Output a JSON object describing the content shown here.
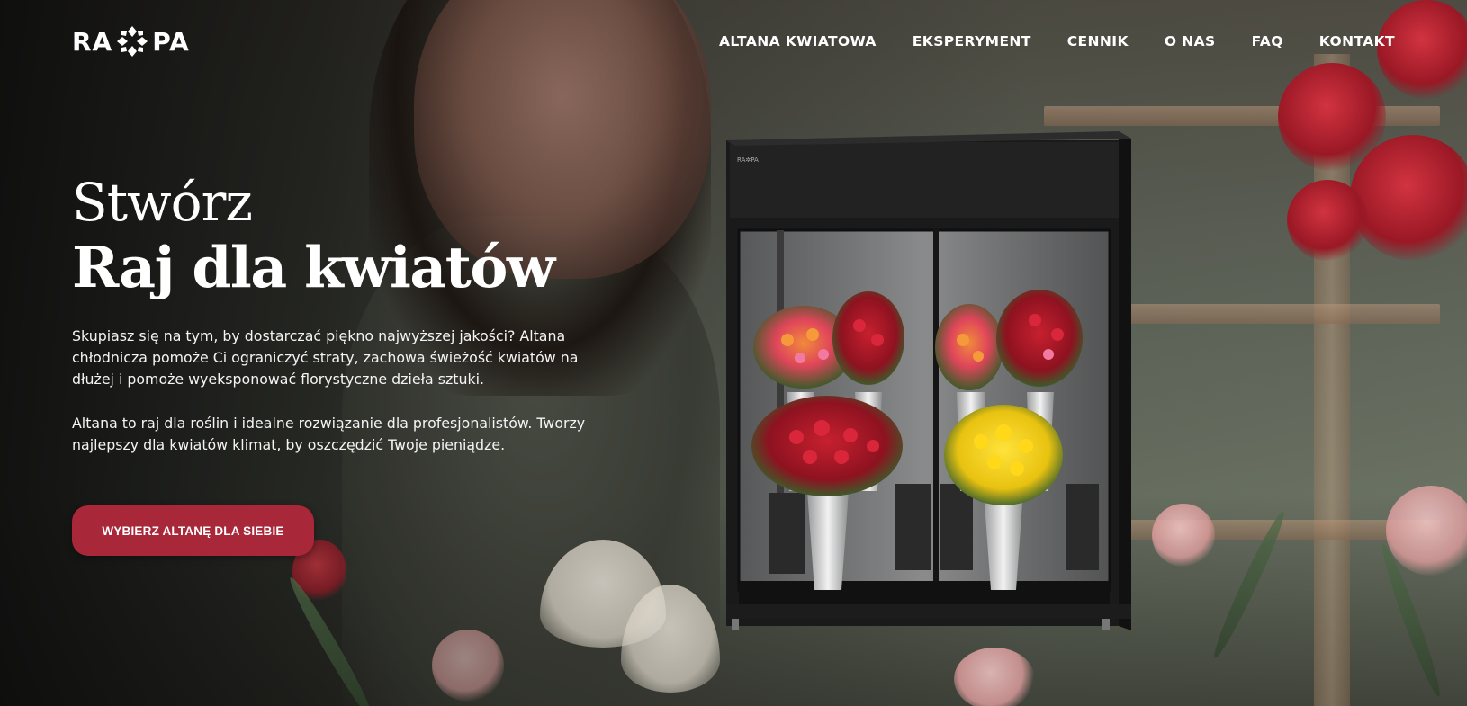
{
  "brand": {
    "logo_left": "RA",
    "logo_right": "PA"
  },
  "nav": {
    "items": [
      {
        "label": "ALTANA KWIATOWA"
      },
      {
        "label": "EKSPERYMENT"
      },
      {
        "label": "CENNIK"
      },
      {
        "label": "O NAS"
      },
      {
        "label": "FAQ"
      },
      {
        "label": "KONTAKT"
      }
    ]
  },
  "hero": {
    "title_line1": "Stwórz",
    "title_line2": "Raj dla kwiatów",
    "paragraph1": "Skupiasz się na tym, by dostarczać piękno najwyższej jakości? Altana chłodnicza pomoże Ci ograniczyć straty, zachowa świeżość kwiatów na dłużej i pomoże wyeksponować florystyczne dzieła sztuki.",
    "paragraph2": "Altana to raj dla roślin i idealne rozwiązanie dla profesjonalistów. Tworzy najlepszy dla kwiatów klimat, by oszczędzić Twoje pieniądze.",
    "cta_label": "WYBIERZ ALTANĘ DLA SIEBIE"
  },
  "colors": {
    "accent": "#a8283a",
    "text": "#ffffff"
  }
}
